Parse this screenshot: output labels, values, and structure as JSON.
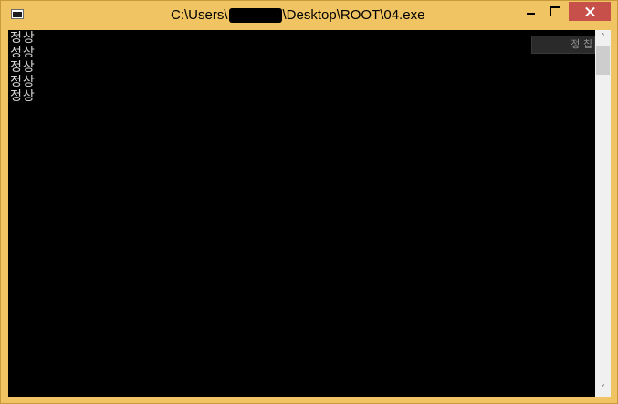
{
  "window": {
    "title_prefix": "C:\\Users\\",
    "title_suffix": "\\Desktop\\ROOT\\04.exe"
  },
  "console": {
    "lines": [
      "정상",
      "정상",
      "정상",
      "정상",
      "정상"
    ],
    "ime_indicator": "정 칩"
  },
  "colors": {
    "frame": "#f0c462",
    "close_button": "#c7504a",
    "console_background": "#000000",
    "console_text": "#d6d6d6"
  },
  "icons": {
    "app": "console-app-icon",
    "minimize": "minimize-icon",
    "maximize": "maximize-icon",
    "close": "close-icon",
    "scroll_up": "chevron-up-icon",
    "scroll_down": "chevron-down-icon"
  },
  "scroll": {
    "up_glyph": "˄",
    "down_glyph": "˅"
  }
}
